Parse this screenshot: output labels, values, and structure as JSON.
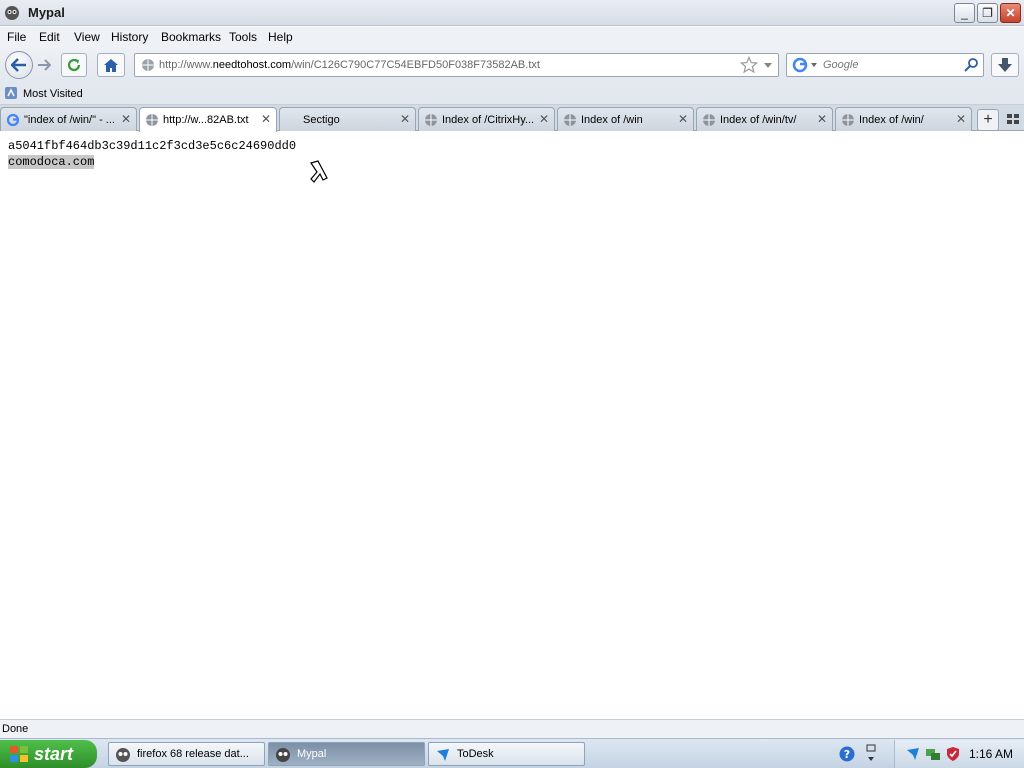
{
  "window": {
    "title": "Mypal",
    "min": "_",
    "max": "❐",
    "close": "✕"
  },
  "menu": [
    "File",
    "Edit",
    "View",
    "History",
    "Bookmarks",
    "Tools",
    "Help"
  ],
  "nav": {
    "url_prefix": "http://www.",
    "url_host": "needtohost.com",
    "url_path": "/win/C126C790C77C54EBFD50F038F73582AB.txt",
    "search_placeholder": "Google"
  },
  "bookmarks": {
    "most_visited": "Most Visited"
  },
  "tabs": [
    {
      "label": "\"index of /win/\" - ...",
      "icon": "google-icon",
      "active": false
    },
    {
      "label": "http://w...82AB.txt",
      "icon": "globe-icon",
      "active": true
    },
    {
      "label": "Sectigo",
      "icon": "none",
      "active": false
    },
    {
      "label": "Index of /CitrixHy...",
      "icon": "globe-icon",
      "active": false
    },
    {
      "label": "Index of /win",
      "icon": "globe-icon",
      "active": false
    },
    {
      "label": "Index of /win/tv/",
      "icon": "globe-icon",
      "active": false
    },
    {
      "label": "Index of /win/",
      "icon": "globe-icon",
      "active": false
    }
  ],
  "content": {
    "line1": "a5041fbf464db3c39d11c2f3cd3e5c6c24690dd0",
    "line2": "comodoca.com"
  },
  "status": {
    "text": "Done"
  },
  "taskbar": {
    "start_label": "start",
    "tasks": [
      {
        "label": "firefox 68 release dat...",
        "active": false
      },
      {
        "label": "Mypal",
        "active": true
      },
      {
        "label": "ToDesk",
        "active": false
      }
    ],
    "clock": "1:16 AM"
  },
  "colors": {
    "accent": "#2f8f2a",
    "titlebar": "#d7dde6",
    "close": "#c3432d"
  }
}
